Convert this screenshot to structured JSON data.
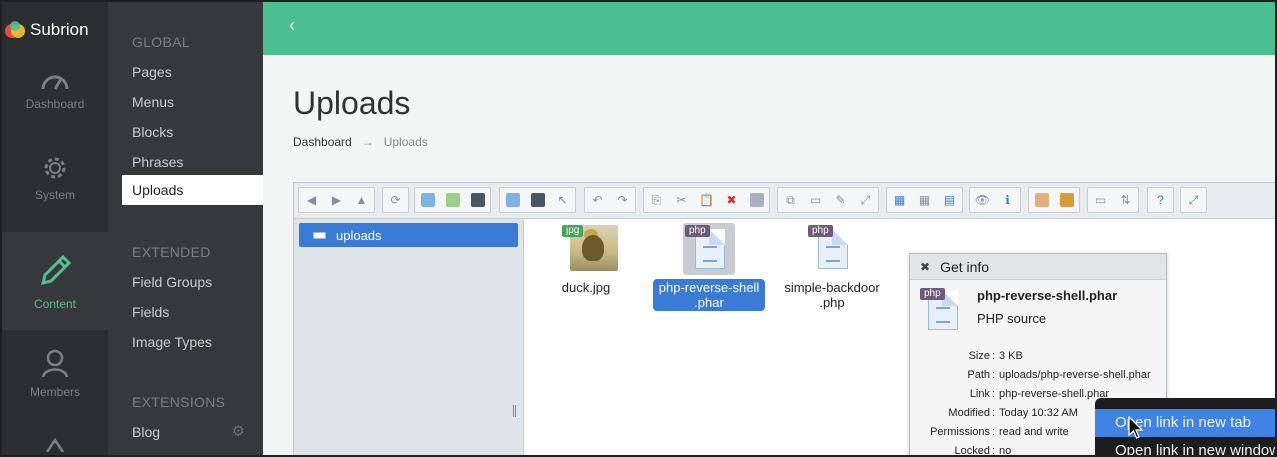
{
  "app": {
    "logo_text": "Subrion"
  },
  "rail": [
    {
      "label": "Dashboard",
      "icon": "speedometer-icon",
      "active": false
    },
    {
      "label": "System",
      "icon": "gear-icon",
      "active": false
    },
    {
      "label": "Content",
      "icon": "pencil-icon",
      "active": true
    },
    {
      "label": "Members",
      "icon": "user-icon",
      "active": false
    }
  ],
  "submenu": {
    "global_title": "GLOBAL",
    "global": [
      "Pages",
      "Menus",
      "Blocks",
      "Phrases",
      "Uploads"
    ],
    "active_item": "Uploads",
    "extended_title": "EXTENDED",
    "extended": [
      "Field Groups",
      "Fields",
      "Image Types"
    ],
    "extensions_title": "EXTENSIONS",
    "extensions": [
      "Blog"
    ]
  },
  "topbar": {
    "collapse_icon": "chevron-left-icon"
  },
  "page": {
    "title": "Uploads",
    "breadcrumb": {
      "home": "Dashboard",
      "separator": "→",
      "current": "Uploads"
    }
  },
  "file_manager": {
    "tree_root": "uploads",
    "files": [
      {
        "name": "duck.jpg",
        "tag": "jpg",
        "selected": false
      },
      {
        "name": "php-reverse-shell\n.phar",
        "tag": "php",
        "selected": true
      },
      {
        "name": "simple-backdoor\n.php",
        "tag": "php",
        "selected": false
      }
    ]
  },
  "info_panel": {
    "title": "Get info",
    "file_name": "php-reverse-shell.phar",
    "kind": "PHP source",
    "tag": "php",
    "rows": [
      {
        "key": "Size",
        "value": "3 KB"
      },
      {
        "key": "Path",
        "value": "uploads/php-reverse-shell.phar"
      },
      {
        "key": "Link",
        "value": "php-reverse-shell.phar"
      },
      {
        "key": "Modified",
        "value": "Today 10:32 AM"
      },
      {
        "key": "Permissions",
        "value": "read and write"
      },
      {
        "key": "Locked",
        "value": "no"
      }
    ]
  },
  "context_menu": {
    "items": [
      "Open link in new tab",
      "Open link in new window"
    ]
  },
  "colors": {
    "topbar": "#4bbf92",
    "accent": "#3a7bd5",
    "rail_active_text": "#4fc08f"
  }
}
